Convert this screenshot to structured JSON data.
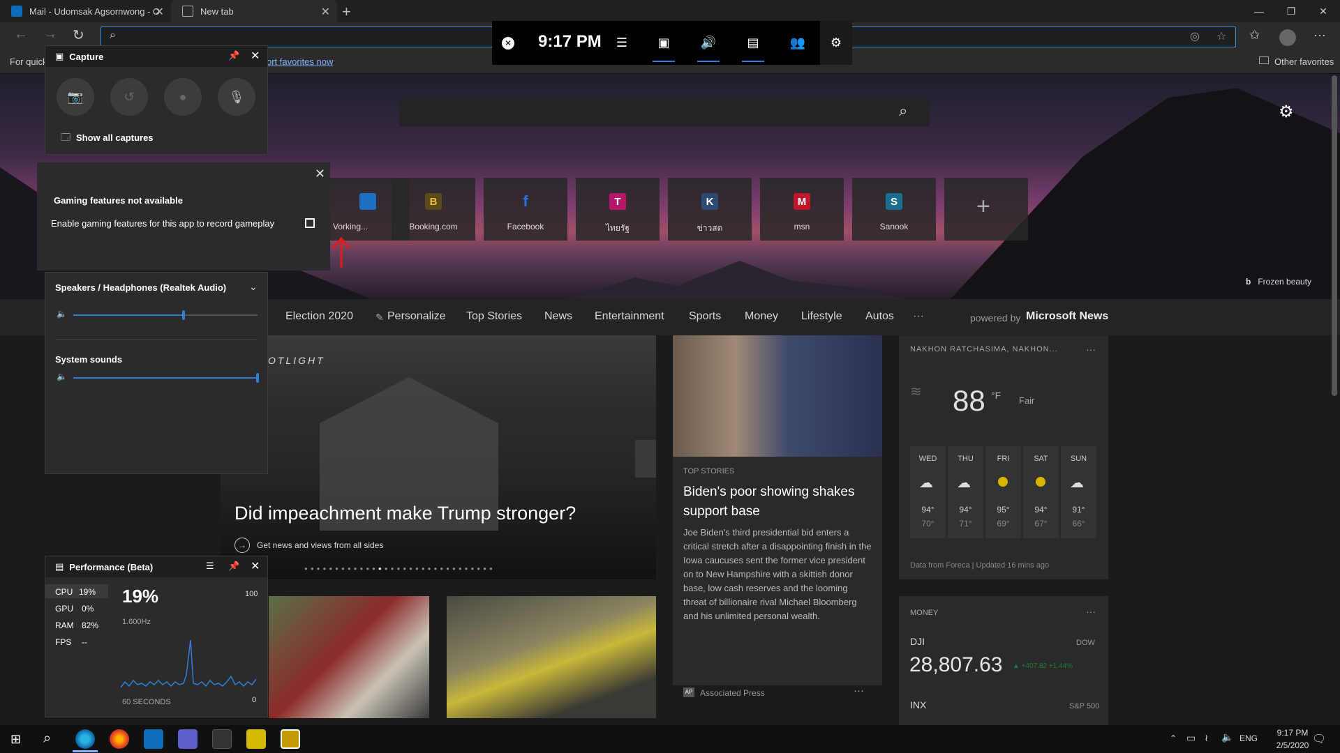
{
  "browser": {
    "tabs": [
      {
        "title": "Mail - Udomsak Agsornwong - O"
      },
      {
        "title": "New tab"
      }
    ],
    "new_tab_symbol": "+",
    "fav_bar_left": "For quick",
    "fav_bar_link": "ort favorites now",
    "other_favorites": "Other favorites"
  },
  "newtab": {
    "photo_credit": "Frozen beauty",
    "tiles": [
      {
        "label": "Vorking...",
        "letter": "",
        "color": "#1e6fbf"
      },
      {
        "label": "Booking.com",
        "letter": "B",
        "color": "#5a4b1c"
      },
      {
        "label": "Facebook",
        "letter": "f",
        "color": "#2a2a2a"
      },
      {
        "label": "ไทยรัฐ",
        "letter": "T",
        "color": "#b5176b"
      },
      {
        "label": "ข่าวสด",
        "letter": "K",
        "color": "#2c4a72"
      },
      {
        "label": "msn",
        "letter": "M",
        "color": "#c0172b"
      },
      {
        "label": "Sanook",
        "letter": "S",
        "color": "#1b6d8f"
      }
    ],
    "add_tile_symbol": "+"
  },
  "news_nav": {
    "items": [
      "Election 2020",
      "Personalize",
      "Top Stories",
      "News",
      "Entertainment",
      "Sports",
      "Money",
      "Lifestyle",
      "Autos",
      "···"
    ],
    "powered_by_prefix": "powered by",
    "powered_by_brand": "Microsoft News"
  },
  "spotlight": {
    "label": "OTLIGHT",
    "headline": "Did impeachment make Trump stronger?",
    "sub": "Get news and views from all sides"
  },
  "top_story": {
    "kicker": "TOP STORIES",
    "headline": "Biden's poor showing shakes support base",
    "body": "Joe Biden's third presidential bid enters a critical stretch after a disappointing finish in the Iowa caucuses sent the former vice president on to New Hampshire with a skittish donor base, low cash reserves and the looming threat of billionaire rival Michael Bloomberg and his unlimited personal wealth.",
    "source": "Associated Press",
    "more": "···"
  },
  "weather": {
    "location": "NAKHON RATCHASIMA, NAKHON...",
    "more": "···",
    "temp": "88",
    "unit": "°F",
    "condition": "Fair",
    "days": [
      {
        "day": "WED",
        "hi": "94°",
        "lo": "70°"
      },
      {
        "day": "THU",
        "hi": "94°",
        "lo": "71°"
      },
      {
        "day": "FRI",
        "hi": "95°",
        "lo": "69°"
      },
      {
        "day": "SAT",
        "hi": "94°",
        "lo": "67°"
      },
      {
        "day": "SUN",
        "hi": "91°",
        "lo": "66°"
      }
    ],
    "footer": "Data from Foreca | Updated 16 mins ago"
  },
  "money": {
    "title": "MONEY",
    "more": "···",
    "dji_label": "DJI",
    "dji_index": "DOW",
    "dji_value": "28,807.63",
    "dji_change": "▲ +407.82 +1.44%",
    "inx_label": "INX",
    "inx_index": "S&P 500"
  },
  "gamebar": {
    "time": "9:17 PM"
  },
  "capture": {
    "title": "Capture",
    "show_all": "Show all captures"
  },
  "notice": {
    "title": "Gaming features not available",
    "text": "Enable gaming features for this app to record gameplay"
  },
  "audio": {
    "device": "Speakers / Headphones (Realtek Audio)",
    "device_level": 0.6,
    "system_label": "System sounds",
    "system_level": 1.0
  },
  "performance": {
    "title": "Performance (Beta)",
    "stats": [
      {
        "name": "CPU",
        "value": "19%"
      },
      {
        "name": "GPU",
        "value": "0%"
      },
      {
        "name": "RAM",
        "value": "82%"
      },
      {
        "name": "FPS",
        "value": "--"
      }
    ],
    "big_value": "19%",
    "freq": "1.600Hz",
    "max": "100",
    "min": "0",
    "window": "60 SECONDS"
  },
  "taskbar": {
    "lang": "ENG",
    "time": "9:17 PM",
    "date": "2/5/2020"
  }
}
